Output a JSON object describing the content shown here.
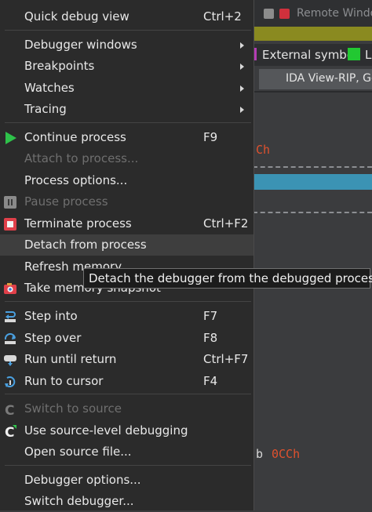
{
  "background": {
    "title": "Remote Window",
    "legend": {
      "external_symbol": "External symbol",
      "second_label": "L"
    },
    "tab_label": "IDA View-RIP, Ge",
    "code_top": "Ch",
    "code_bottom_prefix": "b",
    "code_bottom_value": "0CCh"
  },
  "menu": {
    "quick_debug_view": {
      "label": "Quick debug view",
      "shortcut": "Ctrl+2"
    },
    "debugger_windows": {
      "label": "Debugger windows"
    },
    "breakpoints": {
      "label": "Breakpoints"
    },
    "watches": {
      "label": "Watches"
    },
    "tracing": {
      "label": "Tracing"
    },
    "continue_process": {
      "label": "Continue process",
      "shortcut": "F9"
    },
    "attach_to_process": {
      "label": "Attach to process..."
    },
    "process_options": {
      "label": "Process options..."
    },
    "pause_process": {
      "label": "Pause process"
    },
    "terminate_process": {
      "label": "Terminate process",
      "shortcut": "Ctrl+F2"
    },
    "detach_from_process": {
      "label": "Detach from process"
    },
    "refresh_memory": {
      "label": "Refresh memory"
    },
    "take_memory_snapshot": {
      "label": "Take memory snapshot"
    },
    "step_into": {
      "label": "Step into",
      "shortcut": "F7"
    },
    "step_over": {
      "label": "Step over",
      "shortcut": "F8"
    },
    "run_until_return": {
      "label": "Run until return",
      "shortcut": "Ctrl+F7"
    },
    "run_to_cursor": {
      "label": "Run to cursor",
      "shortcut": "F4"
    },
    "switch_to_source": {
      "label": "Switch to source"
    },
    "use_source_level_debugging": {
      "label": "Use source-level debugging"
    },
    "open_source_file": {
      "label": "Open source file..."
    },
    "debugger_options": {
      "label": "Debugger options..."
    },
    "switch_debugger": {
      "label": "Switch debugger..."
    }
  },
  "tooltip": {
    "text": "Detach the debugger from the debugged process"
  },
  "colors": {
    "menu_bg": "#2b2b2b",
    "hover_bg": "#3e3e3e",
    "play_green": "#2ec24a",
    "terminate_red": "#e0404a",
    "olive_bar": "#8a8a20",
    "selection_blue": "#3b93b4",
    "code_red": "#e0512e"
  }
}
